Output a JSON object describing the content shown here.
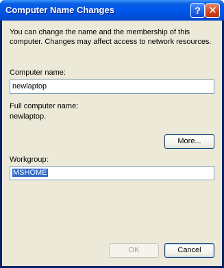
{
  "window": {
    "title": "Computer Name Changes",
    "help_glyph": "?",
    "close_glyph": "✕"
  },
  "description": "You can change the name and the membership of this computer. Changes may affect access to network resources.",
  "computer_name": {
    "label": "Computer name:",
    "value": "newlaptop"
  },
  "full_name": {
    "label": "Full computer name:",
    "value": "newlaptop."
  },
  "more_button": "More...",
  "workgroup": {
    "label": "Workgroup:",
    "value": "MSHOME"
  },
  "ok_button": "OK",
  "cancel_button": "Cancel",
  "colors": {
    "titlebar": "#0058ee",
    "dialog_face": "#ece9d8",
    "selection": "#316ac5"
  }
}
